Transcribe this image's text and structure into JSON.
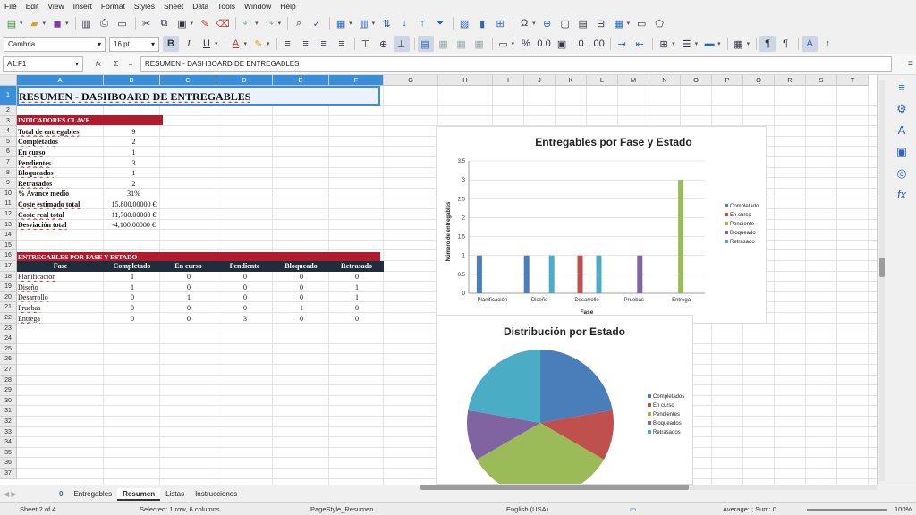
{
  "menu": [
    "File",
    "Edit",
    "View",
    "Insert",
    "Format",
    "Styles",
    "Sheet",
    "Data",
    "Tools",
    "Window",
    "Help"
  ],
  "font": {
    "name": "Cambria",
    "size": "16 pt"
  },
  "formula": {
    "namebox": "A1:F1",
    "fx": "fx",
    "sigma": "Σ",
    "eq": "=",
    "content": "RESUMEN - DASHBOARD DE ENTREGABLES"
  },
  "columns": [
    "A",
    "B",
    "C",
    "D",
    "E",
    "F",
    "G",
    "H",
    "I",
    "J",
    "K",
    "L",
    "M",
    "N",
    "O",
    "P",
    "Q",
    "R",
    "S",
    "T"
  ],
  "rows": [
    "1",
    "2",
    "3",
    "4",
    "5",
    "6",
    "7",
    "8",
    "9",
    "10",
    "11",
    "12",
    "13",
    "14",
    "15",
    "16",
    "17",
    "18",
    "19",
    "20",
    "21",
    "22",
    "23",
    "24",
    "25",
    "26",
    "27",
    "28",
    "29",
    "30",
    "31",
    "32",
    "33",
    "34",
    "35",
    "36",
    "37"
  ],
  "sheet": {
    "title": "RESUMEN - DASHBOARD DE ENTREGABLES",
    "kpi_header": "INDICADORES CLAVE",
    "kpis": [
      {
        "label": "Total de entregables",
        "value": "9"
      },
      {
        "label": "Completados",
        "value": "2"
      },
      {
        "label": "En curso",
        "value": "1"
      },
      {
        "label": "Pendientes",
        "value": "3"
      },
      {
        "label": "Bloqueados",
        "value": "1"
      },
      {
        "label": "Retrasados",
        "value": "2"
      },
      {
        "label": "% Avance medio",
        "value": "31%"
      },
      {
        "label": "Coste estimado total",
        "value": "15,800.00000 €"
      },
      {
        "label": "Coste real total",
        "value": "11,700.00000 €"
      },
      {
        "label": "Desviación total",
        "value": "-4,100.00000 €"
      }
    ],
    "table_header": "ENTREGABLES POR FASE Y ESTADO",
    "table_cols": [
      "Fase",
      "Completado",
      "En curso",
      "Pendiente",
      "Bloqueado",
      "Retrasado"
    ],
    "table_rows": [
      {
        "fase": "Planificación",
        "c": "1",
        "e": "0",
        "p": "0",
        "b": "0",
        "r": "0"
      },
      {
        "fase": "Diseño",
        "c": "1",
        "e": "0",
        "p": "0",
        "b": "0",
        "r": "1"
      },
      {
        "fase": "Desarrollo",
        "c": "0",
        "e": "1",
        "p": "0",
        "b": "0",
        "r": "1"
      },
      {
        "fase": "Pruebas",
        "c": "0",
        "e": "0",
        "p": "0",
        "b": "1",
        "r": "0"
      },
      {
        "fase": "Entrega",
        "c": "0",
        "e": "0",
        "p": "3",
        "b": "0",
        "r": "0"
      }
    ]
  },
  "colors": {
    "Completado": "#4a7ebb",
    "En curso": "#c0504d",
    "Pendiente": "#9bbb59",
    "Bloqueado": "#8064a2",
    "Retrasado": "#4bacc6"
  },
  "chart_data": [
    {
      "type": "bar",
      "title": "Entregables por Fase y Estado",
      "xlabel": "Fase",
      "ylabel": "Número de entregables",
      "categories": [
        "Planificación",
        "Diseño",
        "Desarrollo",
        "Pruebas",
        "Entrega"
      ],
      "ylim": [
        0,
        3.5
      ],
      "yticks": [
        "0",
        "0.5",
        "1",
        "1.5",
        "2",
        "2.5",
        "3",
        "3.5"
      ],
      "legend": "right",
      "series": [
        {
          "name": "Completado",
          "values": [
            1,
            1,
            0,
            0,
            0
          ]
        },
        {
          "name": "En curso",
          "values": [
            0,
            0,
            1,
            0,
            0
          ]
        },
        {
          "name": "Pendiente",
          "values": [
            0,
            0,
            0,
            0,
            3
          ]
        },
        {
          "name": "Bloqueado",
          "values": [
            0,
            0,
            0,
            1,
            0
          ]
        },
        {
          "name": "Retrasado",
          "values": [
            0,
            1,
            1,
            0,
            0
          ]
        }
      ]
    },
    {
      "type": "pie",
      "title": "Distribución por Estado",
      "legend": "right",
      "categories": [
        "Completados",
        "En curso",
        "Pendientes",
        "Bloqueados",
        "Retrasados"
      ],
      "values": [
        2,
        1,
        3,
        1,
        2
      ]
    }
  ],
  "tabs": {
    "first": "0",
    "items": [
      "Entregables",
      "Resumen",
      "Listas",
      "Instrucciones"
    ],
    "active": "Resumen"
  },
  "status": {
    "sheet": "Sheet 2 of 4",
    "selected": "Selected: 1 row, 6 columns",
    "pagestyle": "PageStyle_Resumen",
    "lang": "English (USA)",
    "avg": "Average: ; Sum: 0",
    "zoom": "100%"
  }
}
